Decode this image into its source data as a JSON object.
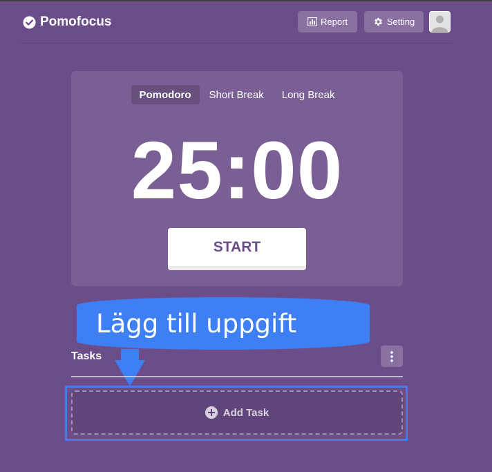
{
  "header": {
    "brand": "Pomofocus",
    "brand_icon": "check-circle-icon",
    "report_label": "Report",
    "report_icon": "bar-chart-icon",
    "setting_label": "Setting",
    "setting_icon": "gear-icon",
    "avatar_icon": "user-avatar-icon"
  },
  "timer": {
    "tabs": [
      {
        "label": "Pomodoro",
        "active": true
      },
      {
        "label": "Short Break",
        "active": false
      },
      {
        "label": "Long Break",
        "active": false
      }
    ],
    "time": "25:00",
    "start_label": "START"
  },
  "callout": {
    "text": "Lägg till uppgift",
    "color": "#3e7ff4"
  },
  "tasks": {
    "title": "Tasks",
    "menu_icon": "vertical-dots-icon",
    "add_label": "Add Task",
    "add_icon": "plus-circle-icon"
  },
  "colors": {
    "background": "#6b4d8a",
    "accent": "#3e7ff4"
  }
}
